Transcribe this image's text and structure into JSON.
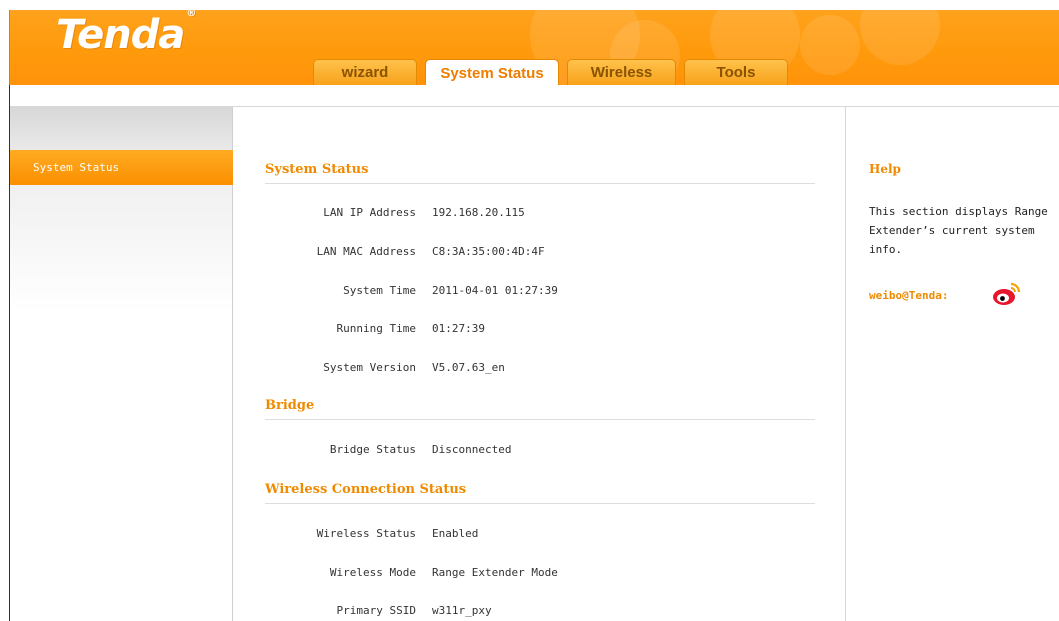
{
  "header": {
    "logo_text": "Tenda",
    "logo_mark": "®",
    "tabs": [
      {
        "label": "wizard",
        "active": false
      },
      {
        "label": "System Status",
        "active": true
      },
      {
        "label": "Wireless",
        "active": false
      },
      {
        "label": "Tools",
        "active": false
      }
    ]
  },
  "sidebar": {
    "items": [
      {
        "label": "System Status",
        "active": true
      }
    ]
  },
  "main": {
    "sections": {
      "system": {
        "title": "System Status",
        "rows": [
          {
            "label": "LAN IP Address",
            "value": "192.168.20.115"
          },
          {
            "label": "LAN MAC Address",
            "value": "C8:3A:35:00:4D:4F"
          },
          {
            "label": "System Time",
            "value": "2011-04-01 01:27:39"
          },
          {
            "label": "Running Time",
            "value": "01:27:39"
          },
          {
            "label": "System Version",
            "value": "V5.07.63_en"
          }
        ]
      },
      "bridge": {
        "title": "Bridge",
        "rows": [
          {
            "label": "Bridge Status",
            "value": "Disconnected"
          }
        ]
      },
      "wireless": {
        "title": "Wireless Connection Status",
        "rows": [
          {
            "label": "Wireless Status",
            "value": "Enabled"
          },
          {
            "label": "Wireless Mode",
            "value": "Range Extender Mode"
          },
          {
            "label": "Primary SSID",
            "value": "w311r_pxy"
          }
        ]
      }
    }
  },
  "help": {
    "title": "Help",
    "text": "This section displays Range Extender’s current system info.",
    "weibo_label": "weibo@Tenda:",
    "weibo_icon": "weibo-icon"
  },
  "colors": {
    "accent": "#ef8a00",
    "header_orange": "#ff9a0c",
    "tab_inactive": "#f7a21a"
  }
}
